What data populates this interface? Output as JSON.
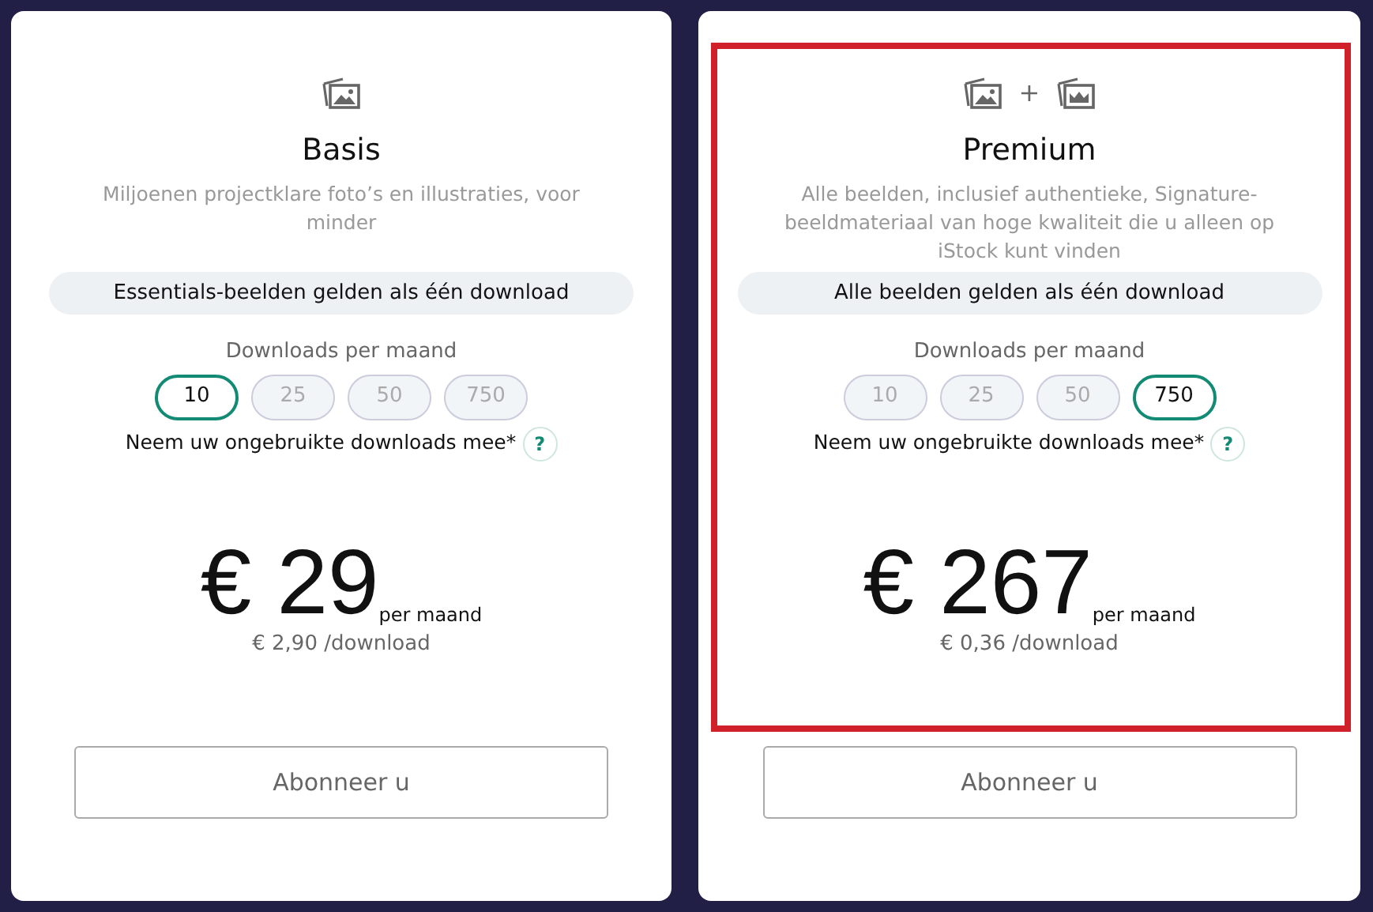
{
  "plans": [
    {
      "icons": [
        {
          "kind": "photo"
        }
      ],
      "title": "Basis",
      "description": "Miljoenen projectklare foto’s en illustraties, voor minder",
      "highlighted": false,
      "note": "Essentials-beelden gelden als één download",
      "downloads_label": "Downloads per maand",
      "options": [
        {
          "label": "10",
          "selected": true
        },
        {
          "label": "25",
          "selected": false
        },
        {
          "label": "50",
          "selected": false
        },
        {
          "label": "750",
          "selected": false
        }
      ],
      "rollover": "Neem uw ongebruikte downloads mee*",
      "help": "?",
      "price": "€ 29",
      "period": "per maand",
      "per_download": "€ 2,90 /download",
      "button": "Abonneer u"
    },
    {
      "icons": [
        {
          "kind": "photo"
        },
        {
          "kind": "crown"
        }
      ],
      "icon_joiner": "+",
      "title": "Premium",
      "description": "Alle beelden, inclusief authentieke, Signature-beeldmateriaal van hoge kwaliteit die u alleen op iStock kunt vinden",
      "highlighted": true,
      "note": "Alle beelden gelden als één download",
      "downloads_label": "Downloads per maand",
      "options": [
        {
          "label": "10",
          "selected": false
        },
        {
          "label": "25",
          "selected": false
        },
        {
          "label": "50",
          "selected": false
        },
        {
          "label": "750",
          "selected": true
        }
      ],
      "rollover": "Neem uw ongebruikte downloads mee*",
      "help": "?",
      "price": "€ 267",
      "period": "per maand",
      "per_download": "€ 0,36 /download",
      "button": "Abonneer u"
    }
  ]
}
